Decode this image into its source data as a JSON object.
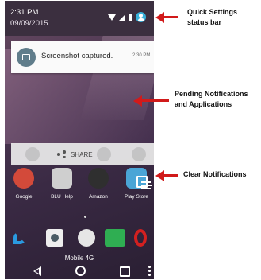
{
  "status_bar": {
    "time": "2:31 PM",
    "date": "09/09/2015"
  },
  "notification": {
    "title": "Screenshot captured.",
    "time": "2:30 PM",
    "icon": "image-icon"
  },
  "share_bar": {
    "label": "SHARE",
    "icon": "share-icon"
  },
  "apps": [
    {
      "label": "Google",
      "icon": "google-folder-icon"
    },
    {
      "label": "BLU Help",
      "icon": "blu-help-icon"
    },
    {
      "label": "Amazon",
      "icon": "amazon-icon"
    },
    {
      "label": "Play Store",
      "icon": "play-store-icon"
    }
  ],
  "dock": [
    {
      "icon": "phone-icon"
    },
    {
      "icon": "camera-icon"
    },
    {
      "icon": "app-drawer-icon"
    },
    {
      "icon": "messaging-icon"
    },
    {
      "icon": "opera-icon"
    }
  ],
  "carrier": "Mobile 4G",
  "callouts": {
    "quick_settings": {
      "line1": "Quick Settings",
      "line2": "status bar"
    },
    "pending": {
      "line1": "Pending Notifications",
      "line2": "and Applications"
    },
    "clear": {
      "line1": "Clear Notifications"
    }
  },
  "colors": {
    "arrow": "#d11a1a",
    "status_bar": "#3b2f3f",
    "user_icon": "#37b0d9"
  }
}
